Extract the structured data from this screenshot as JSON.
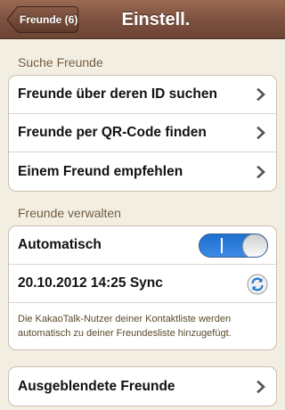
{
  "navbar": {
    "back_label": "Freunde (6)",
    "title": "Einstell."
  },
  "sections": {
    "find_header": "Suche Freunde",
    "find_items": [
      {
        "label": "Freunde über deren ID suchen"
      },
      {
        "label": "Freunde per QR-Code finden"
      },
      {
        "label": "Einem Freund empfehlen"
      }
    ],
    "manage_header": "Freunde verwalten",
    "auto_label": "Automatisch",
    "auto_enabled": true,
    "sync_label": "20.10.2012 14:25 Sync",
    "auto_note": "Die KakaoTalk-Nutzer deiner Kontaktliste werden automatisch zu deiner Freundesliste hinzugefügt.",
    "hidden_label": "Ausgeblendete Freunde"
  },
  "colors": {
    "navbar": "#7d5140",
    "background": "#f3eee2",
    "section_header": "#6f5a3a",
    "toggle_on": "#2f7fe0"
  },
  "icons": [
    "chevron-right-icon",
    "sync-icon",
    "back-arrow-icon"
  ]
}
